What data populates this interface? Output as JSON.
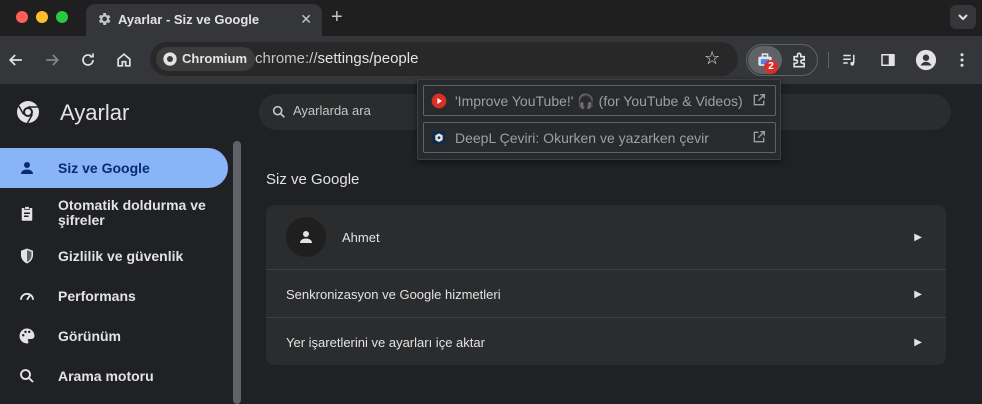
{
  "tab": {
    "title": "Ayarlar - Siz ve Google",
    "close": "✕",
    "new_tab": "+"
  },
  "omnibox": {
    "chip": "Chromium",
    "url_host": "chrome://",
    "url_path": "settings/people",
    "star": "☆"
  },
  "extensions": {
    "badge_count": "2"
  },
  "sidebar": {
    "title": "Ayarlar",
    "items": [
      {
        "label": "Siz ve Google",
        "icon": "person-icon",
        "active": true
      },
      {
        "label": "Otomatik doldurma ve şifreler",
        "icon": "clipboard-icon"
      },
      {
        "label": "Gizlilik ve güvenlik",
        "icon": "shield-icon"
      },
      {
        "label": "Performans",
        "icon": "speedometer-icon"
      },
      {
        "label": "Görünüm",
        "icon": "palette-icon"
      },
      {
        "label": "Arama motoru",
        "icon": "search-icon"
      }
    ]
  },
  "search": {
    "placeholder": "Ayarlarda ara"
  },
  "main": {
    "section_title": "Siz ve Google",
    "profile_name": "Ahmet",
    "rows": [
      {
        "label": "Senkronizasyon ve Google hizmetleri"
      },
      {
        "label": "Yer işaretlerini ve ayarları içe aktar"
      }
    ]
  },
  "popup": {
    "items": [
      {
        "label": "'Improve YouTube!' 🎧 (for YouTube & Videos)",
        "icon": "youtube-play-icon",
        "color": "#d93025"
      },
      {
        "label": "DeepL Çeviri: Okurken ve yazarken çevir",
        "icon": "deepl-icon",
        "color": "#0f2b46"
      }
    ]
  },
  "colors": {
    "accent": "#8ab4f8",
    "badge": "#d93025"
  }
}
